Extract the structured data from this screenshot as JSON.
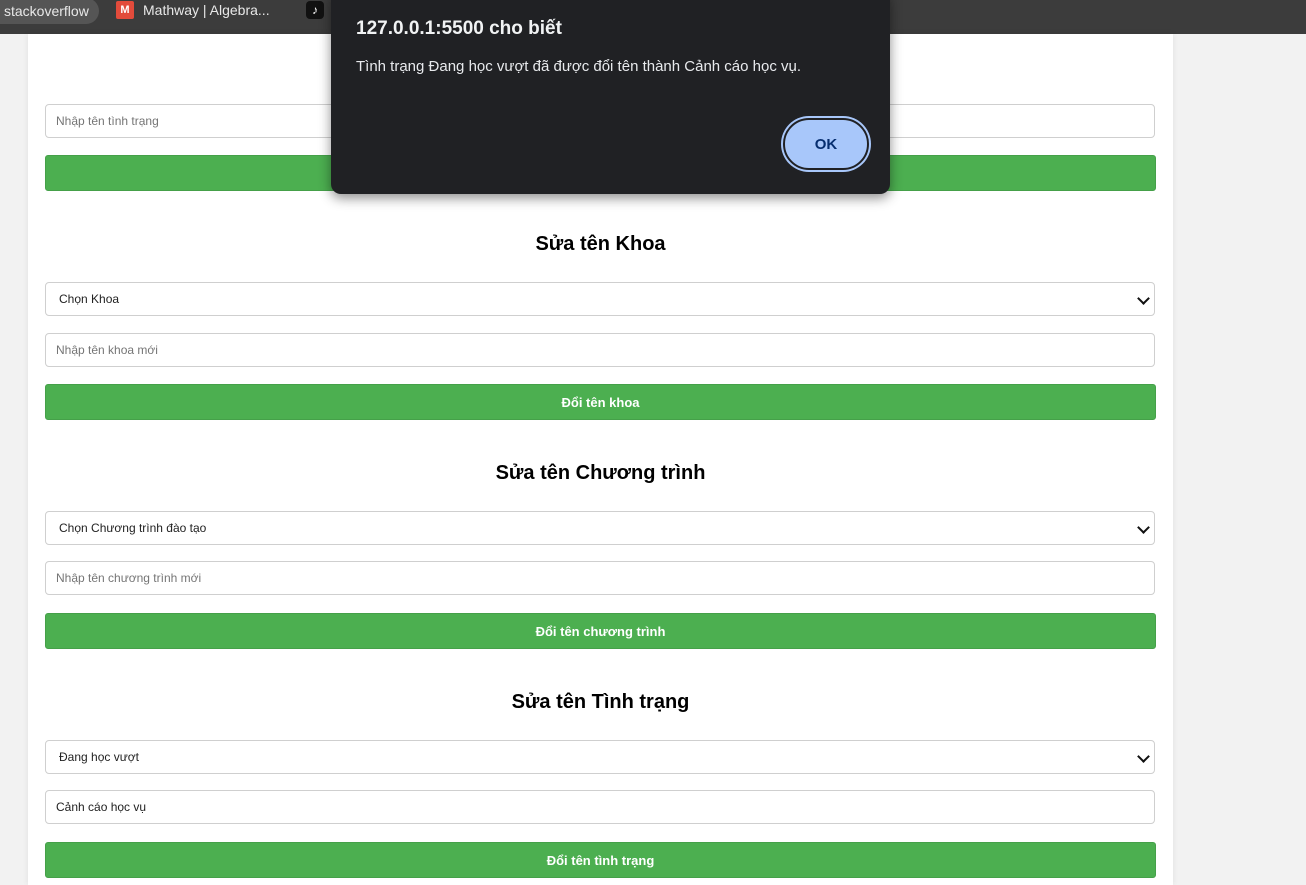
{
  "bookmarks": [
    {
      "label": "stackoverflow"
    },
    {
      "label": "Mathway | Algebra..."
    },
    {
      "label": ""
    }
  ],
  "form_top": {
    "status_placeholder": "Nhập tên tình trạng"
  },
  "faculty_section": {
    "title": "Sửa tên Khoa",
    "select_value": "Chọn Khoa",
    "input_placeholder": "Nhập tên khoa mới",
    "button_label": "Đổi tên khoa"
  },
  "program_section": {
    "title": "Sửa tên Chương trình",
    "select_value": "Chọn Chương trình đào tạo",
    "input_placeholder": "Nhập tên chương trình mới",
    "button_label": "Đổi tên chương trình"
  },
  "status_section": {
    "title": "Sửa tên Tình trạng",
    "select_value": "Đang học vượt",
    "input_value": "Cảnh cáo học vụ",
    "button_label": "Đổi tên tình trạng"
  },
  "alert": {
    "title": "127.0.0.1:5500 cho biết",
    "message": "Tình trạng Đang học vượt đã được đổi tên thành Cảnh cáo học vụ.",
    "ok_label": "OK"
  },
  "colors": {
    "button_green": "#4caf50",
    "alert_bg": "#202124",
    "ok_button": "#a8c7fa"
  }
}
